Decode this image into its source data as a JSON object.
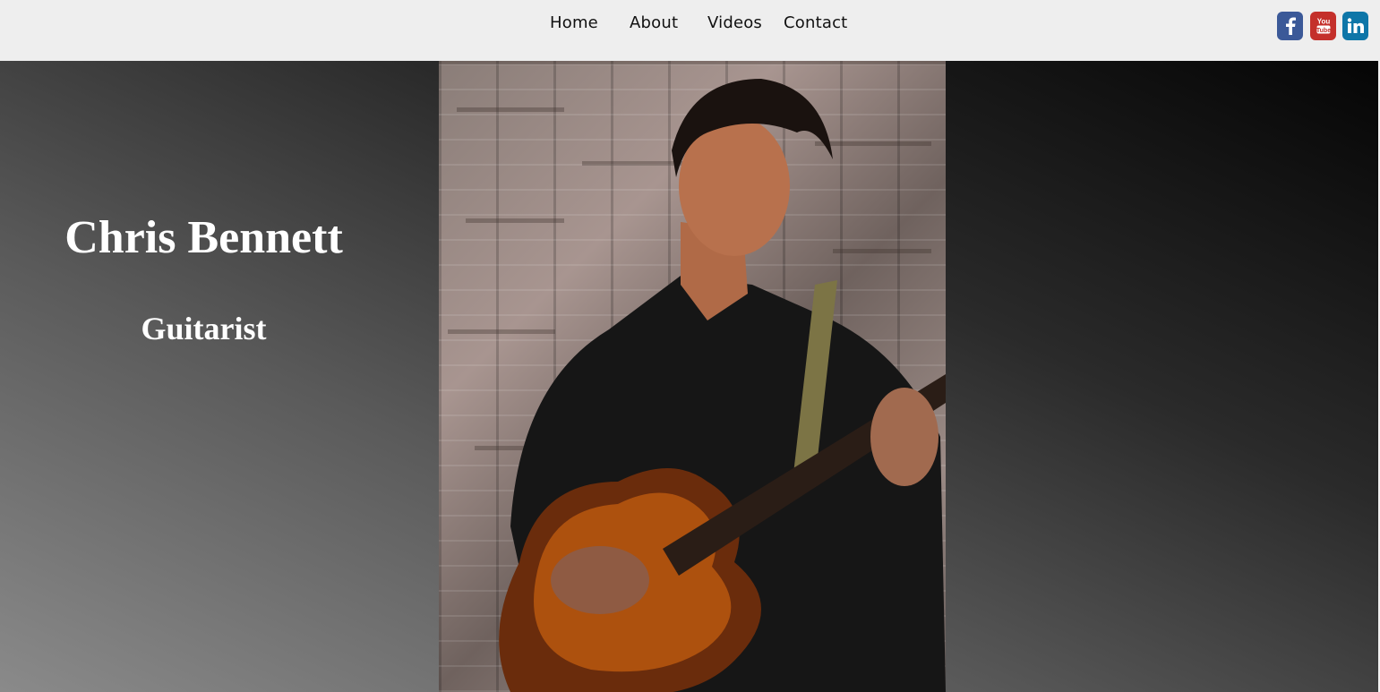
{
  "nav": {
    "items": [
      {
        "label": "Home"
      },
      {
        "label": "About"
      },
      {
        "label": "Videos"
      },
      {
        "label": "Contact"
      }
    ]
  },
  "social": [
    {
      "name": "facebook-icon",
      "glyph": "f",
      "color": "#3b5998"
    },
    {
      "name": "youtube-icon",
      "glyph": "You\nTube",
      "color": "#c4302b"
    },
    {
      "name": "linkedin-icon",
      "glyph": "in",
      "color": "#0e76a8"
    }
  ],
  "hero": {
    "title": "Chris Bennett",
    "subtitle": "Guitarist"
  },
  "colors": {
    "topbar": "#eeeeee",
    "gradient_dark": "#050505",
    "gradient_light": "#8a8a8a",
    "text": "#ffffff"
  }
}
